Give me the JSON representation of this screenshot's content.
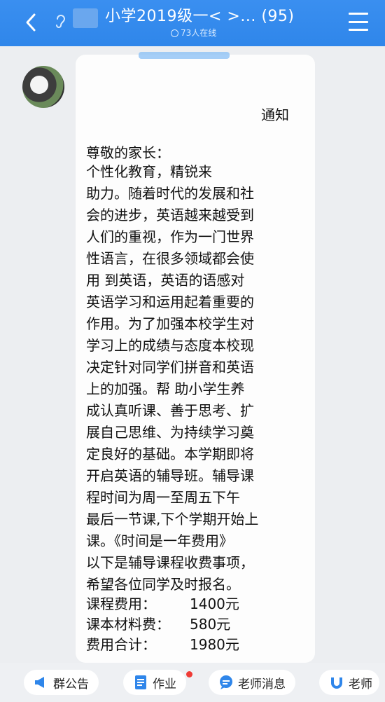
{
  "header": {
    "title": "小学2019级一<  >... (95)",
    "online_text": "73人在线",
    "accent_color": "#3a8ff0"
  },
  "message": {
    "notice_title": "通知",
    "greeting": "尊敬的家长：",
    "paragraph": "        个性化教育，精锐来\n助力。随着时代的发展和社\n会的进步，英语越来越受到\n人们的重视，作为一门世界\n性语言，在很多领域都会使\n用 到英语，英语的语感对\n英语学习和运用起着重要的\n作用。为了加强本校学生对\n学习上的成绩与态度本校现\n决定针对同学们拼音和英语\n上的加强。帮 助小学生养\n成认真听课、善于思考、扩\n展自己思维、为持续学习奠\n定良好的基础。本学期即将\n开启英语的辅导班。辅导课\n程时间为周一至周五下午\n最后一节课,下个学期开始上\n课。《时间是一年费用》\n以下是辅导课程收费事项，\n希望各位同学及时报名。",
    "fees": [
      {
        "label": "课程费用：",
        "value": "1400元"
      },
      {
        "label": "课本材料费：",
        "value": "580元"
      },
      {
        "label": "费用合计：",
        "value": "1980元"
      }
    ]
  },
  "bottom_bar": {
    "items": [
      {
        "label": "群公告",
        "icon": "megaphone-icon"
      },
      {
        "label": "作业",
        "icon": "document-icon"
      },
      {
        "label": "老师消息",
        "icon": "chat-bubble-icon"
      },
      {
        "label": "老师",
        "icon": "teacher-icon"
      }
    ]
  }
}
